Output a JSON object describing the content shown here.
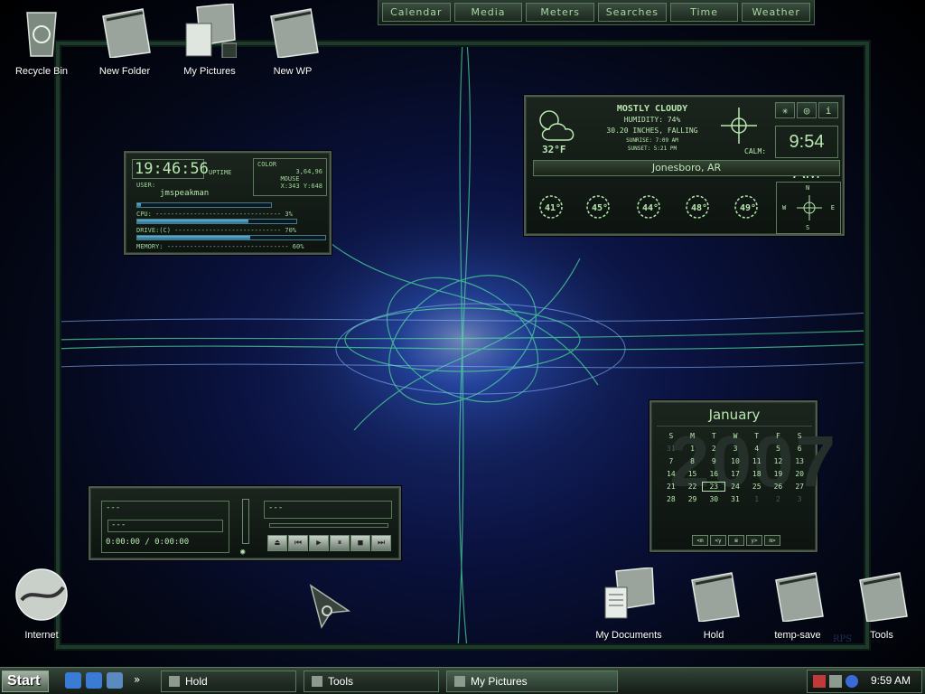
{
  "top_tabs": [
    "Calendar",
    "Media",
    "Meters",
    "Searches",
    "Time",
    "Weather"
  ],
  "desktop_icons": {
    "recycle_bin": "Recycle Bin",
    "new_folder": "New Folder",
    "my_pictures": "My Pictures",
    "new_wp": "New WP",
    "internet": "Internet",
    "my_documents": "My Documents",
    "hold": "Hold",
    "temp_save": "temp-save",
    "tools": "Tools"
  },
  "sysmon": {
    "clock": "19:46:56",
    "uptime_label": "UPTIME",
    "user_label": "USER:",
    "user_name": "jmspeakman",
    "color_label": "COLOR",
    "color_value": "3,64,96",
    "mouse_label": "MOUSE",
    "mouse_value": "X:343  Y:648",
    "cpu_label": "CPU: --------------------------------- 3%",
    "cpu_pct": 3,
    "drive_label": "DRIVE:(C) ---------------------------- 70%",
    "drive_pct": 70,
    "memory_label": "MEMORY: -------------------------------- 60%",
    "memory_pct": 60
  },
  "weather": {
    "condition": "MOSTLY CLOUDY",
    "humidity": "HUMIDITY: 74%",
    "pressure": "30.20 INCHES, FALLING",
    "sunrise": "SUNRISE: 7:09 AM",
    "sunset": "SUNSET: 5:21 PM",
    "temp": "32°F",
    "wind": "CALM:",
    "time": "9:54 AM",
    "location": "Jonesboro, AR",
    "forecast": [
      "41°",
      "45°",
      "44°",
      "48°",
      "49°"
    ],
    "compass": {
      "n": "N",
      "s": "S",
      "e": "E",
      "w": "W"
    },
    "buttons": [
      "✳",
      "◎",
      "i"
    ]
  },
  "media": {
    "track1": "---",
    "track2": "---",
    "track3": "---",
    "time": "0:00:00 / 0:00:00",
    "controls": [
      "⏏",
      "⏮",
      "▶",
      "⏸",
      "■",
      "⏭"
    ]
  },
  "calendar": {
    "month": "January",
    "year": "2007",
    "weekdays": [
      "S",
      "M",
      "T",
      "W",
      "T",
      "F",
      "S"
    ],
    "days": [
      {
        "d": "31",
        "o": true
      },
      {
        "d": "1"
      },
      {
        "d": "2"
      },
      {
        "d": "3"
      },
      {
        "d": "4"
      },
      {
        "d": "5"
      },
      {
        "d": "6"
      },
      {
        "d": "7"
      },
      {
        "d": "8"
      },
      {
        "d": "9"
      },
      {
        "d": "10"
      },
      {
        "d": "11"
      },
      {
        "d": "12"
      },
      {
        "d": "13"
      },
      {
        "d": "14"
      },
      {
        "d": "15"
      },
      {
        "d": "16"
      },
      {
        "d": "17"
      },
      {
        "d": "18"
      },
      {
        "d": "19"
      },
      {
        "d": "20"
      },
      {
        "d": "21"
      },
      {
        "d": "22"
      },
      {
        "d": "23",
        "today": true
      },
      {
        "d": "24"
      },
      {
        "d": "25"
      },
      {
        "d": "26"
      },
      {
        "d": "27"
      },
      {
        "d": "28"
      },
      {
        "d": "29"
      },
      {
        "d": "30"
      },
      {
        "d": "31"
      },
      {
        "d": "1",
        "o": true
      },
      {
        "d": "2",
        "o": true
      },
      {
        "d": "3",
        "o": true
      }
    ],
    "nav": [
      "<m",
      "<y",
      "※",
      "y>",
      "m>"
    ]
  },
  "taskbar": {
    "start": "Start",
    "buttons": [
      "Hold",
      "Tools",
      "My Pictures"
    ],
    "clock": "9:59 AM",
    "watermark": "RPS"
  }
}
